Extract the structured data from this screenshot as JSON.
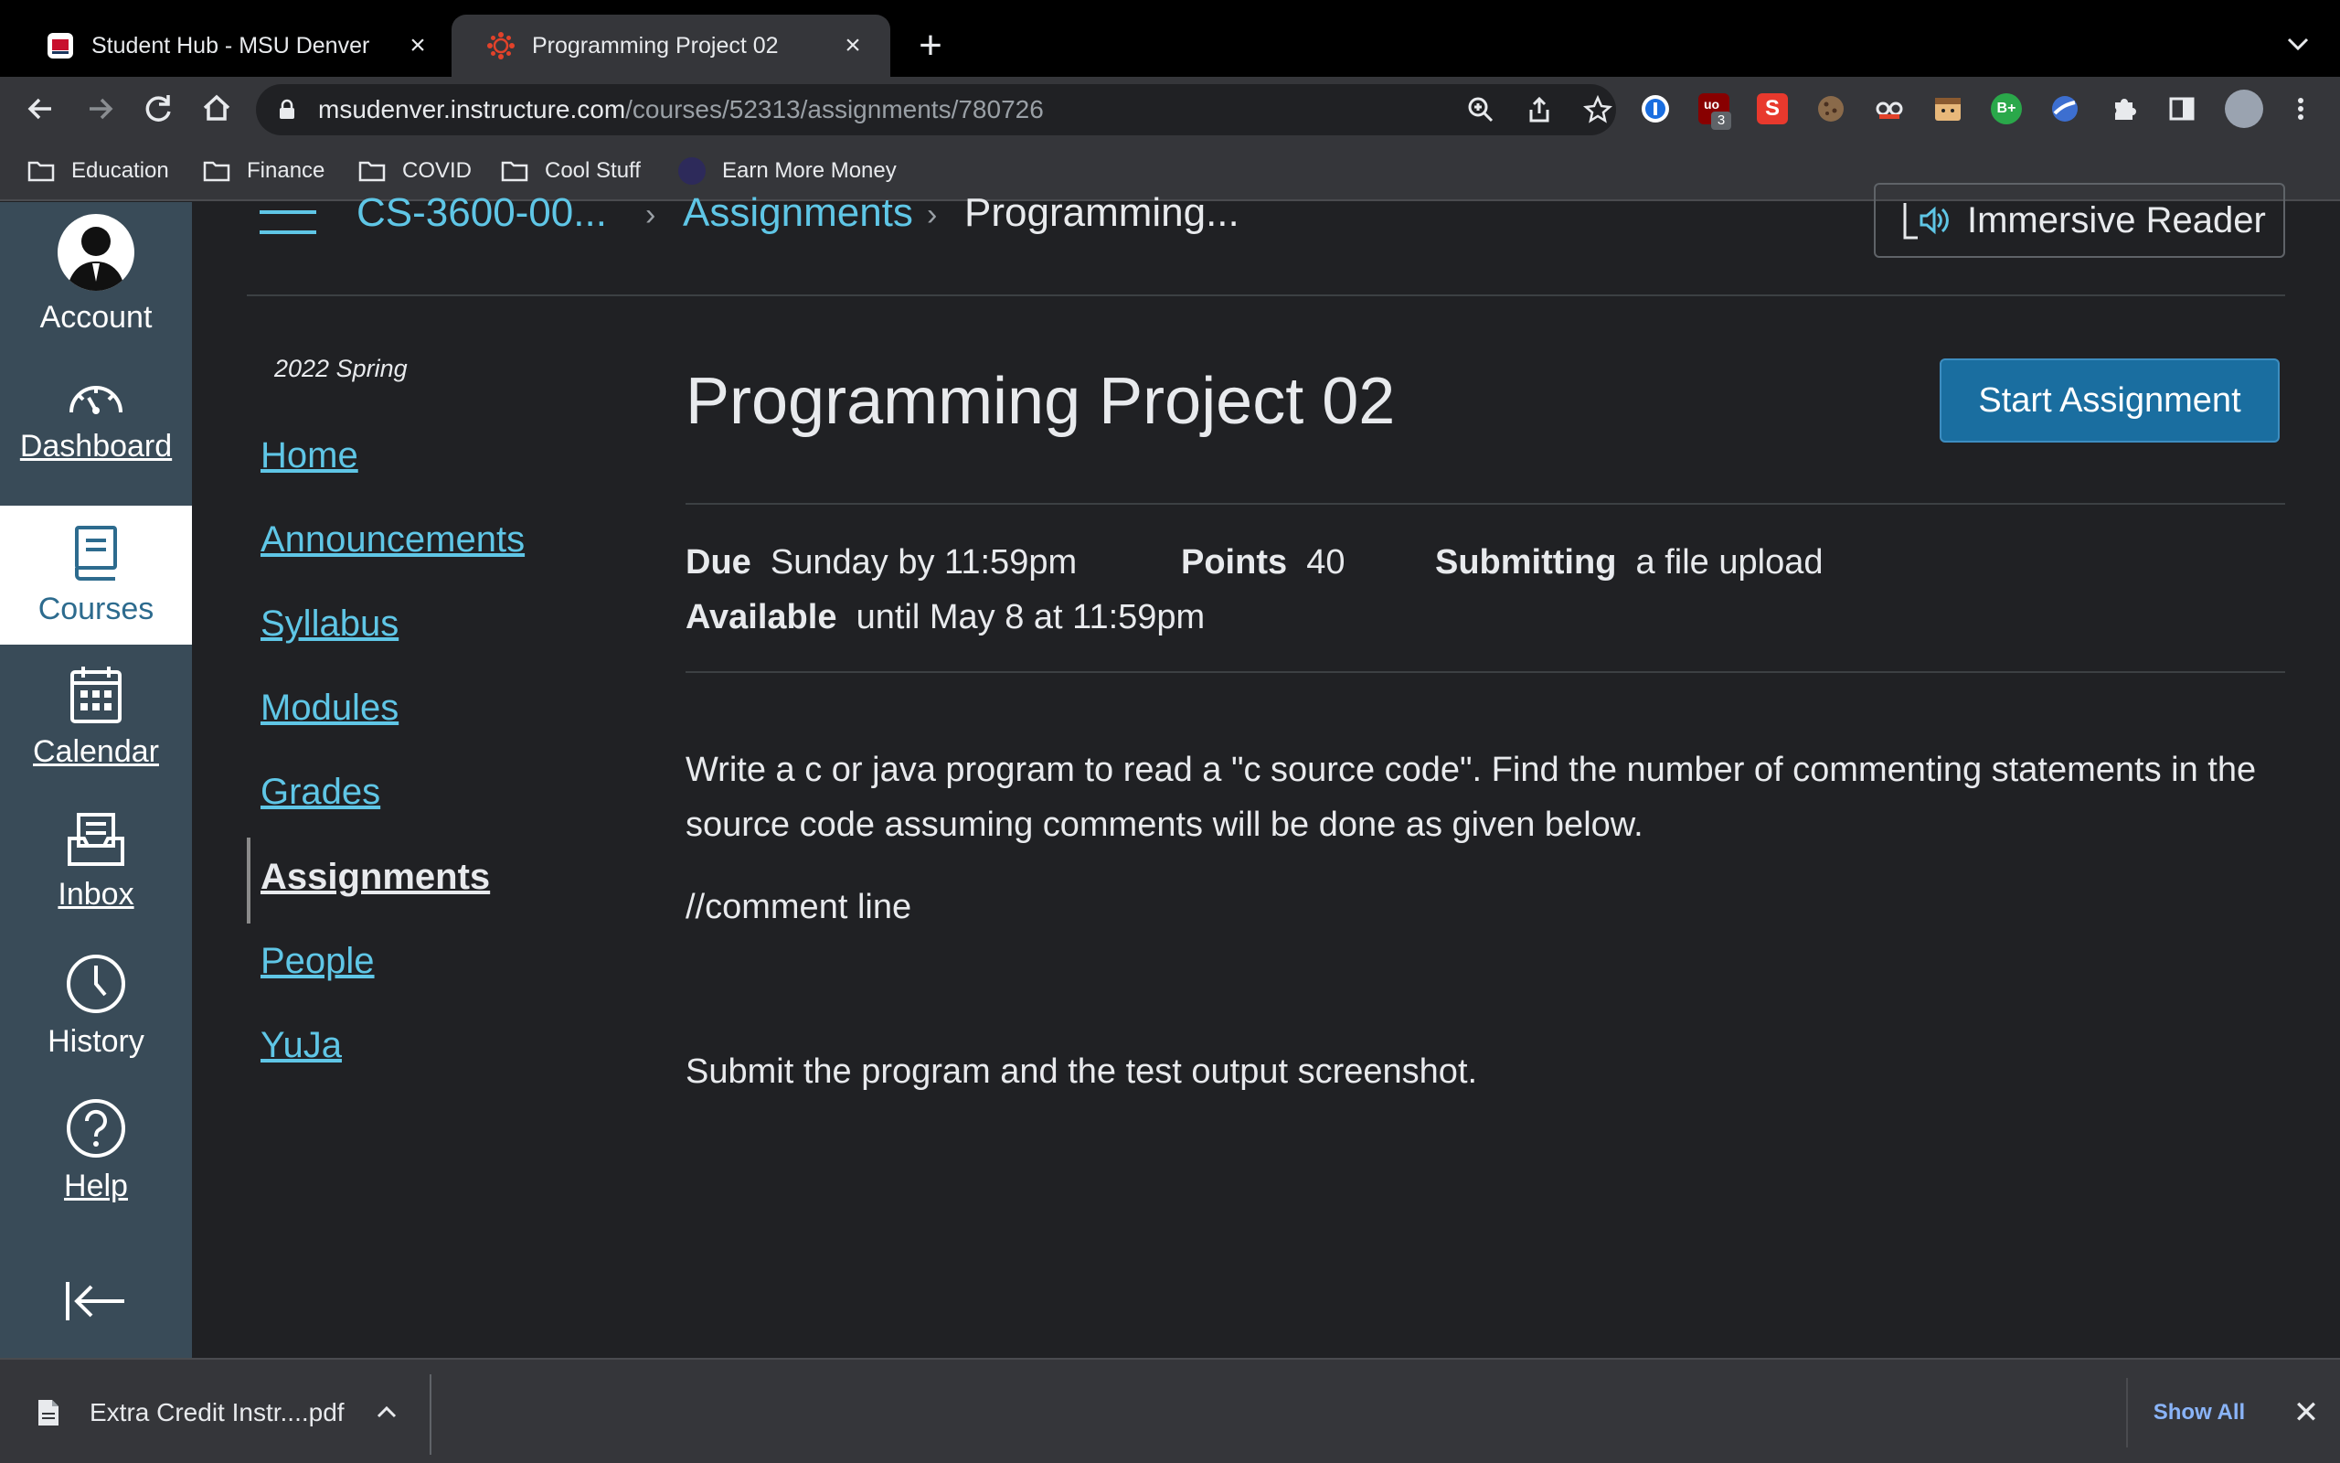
{
  "browser": {
    "tabs": [
      {
        "title": "Student Hub - MSU Denver",
        "active": false
      },
      {
        "title": "Programming Project 02",
        "active": true
      }
    ],
    "url_host": "msudenver.instructure.com",
    "url_path": "/courses/52313/assignments/780726",
    "bookmarks": [
      "Education",
      "Finance",
      "COVID",
      "Cool Stuff",
      "Earn More Money"
    ],
    "ublock_badge": "3",
    "extension_badge_s": "S",
    "extension_badge_b": "B+"
  },
  "global_nav": {
    "items": [
      {
        "label": "Account",
        "icon": "avatar-icon"
      },
      {
        "label": "Dashboard",
        "icon": "dashboard-icon"
      },
      {
        "label": "Courses",
        "icon": "courses-icon"
      },
      {
        "label": "Calendar",
        "icon": "calendar-icon"
      },
      {
        "label": "Inbox",
        "icon": "inbox-icon"
      },
      {
        "label": "History",
        "icon": "history-icon"
      },
      {
        "label": "Help",
        "icon": "help-icon"
      }
    ]
  },
  "breadcrumb": {
    "course": "CS-3600-00...",
    "section": "Assignments",
    "current": "Programming..."
  },
  "immersive_reader": "Immersive Reader",
  "course_nav": {
    "term": "2022 Spring",
    "items": [
      "Home",
      "Announcements",
      "Syllabus",
      "Modules",
      "Grades",
      "Assignments",
      "People",
      "YuJa"
    ],
    "active": "Assignments"
  },
  "assignment": {
    "title": "Programming Project 02",
    "start_button": "Start Assignment",
    "due_label": "Due",
    "due_value": "Sunday by 11:59pm",
    "points_label": "Points",
    "points_value": "40",
    "submitting_label": "Submitting",
    "submitting_value": "a file upload",
    "available_label": "Available",
    "available_value": "until May 8 at 11:59pm",
    "description_p1": "Write a c or java program to read a \"c  source code\". Find the number of commenting statements in the source code assuming comments will be done as given below.",
    "description_p2": "//comment line",
    "description_p3": "Submit the program and the test output screenshot."
  },
  "downloads": {
    "file": "Extra Credit Instr....pdf",
    "show_all": "Show All"
  },
  "colors": {
    "link": "#5fc6e6",
    "nav_bg": "#394b58",
    "button": "#1a6ea0",
    "page_bg": "#202124"
  }
}
